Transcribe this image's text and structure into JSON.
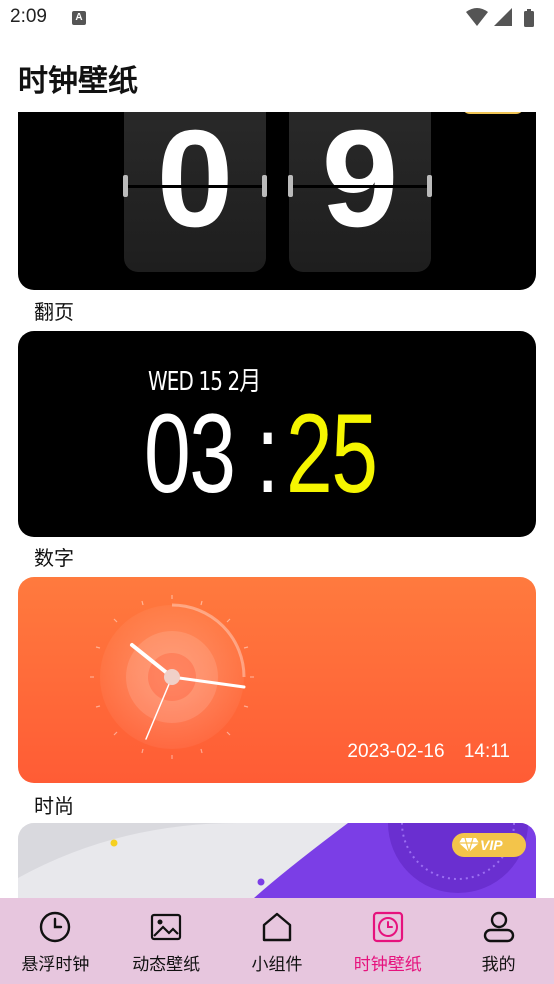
{
  "status_bar": {
    "time": "2:09",
    "notification_icon": "text-a-icon",
    "system_icons": [
      "wifi-icon",
      "signal-icon",
      "battery-icon"
    ]
  },
  "page": {
    "title": "时钟壁纸"
  },
  "cards": [
    {
      "kind": "flip",
      "label": "翻页",
      "digits": [
        "0",
        "9"
      ]
    },
    {
      "kind": "digital",
      "label": "数字",
      "date": "WED 15 2月",
      "hours": "03",
      "colon": ":",
      "minutes": "25",
      "minutes_color": "#f5f500"
    },
    {
      "kind": "fashion",
      "label": "时尚",
      "date": "2023-02-16",
      "time": "14:11"
    },
    {
      "kind": "premium",
      "badge": "VIP",
      "badge_icon": "diamond-icon",
      "accent": "#7b3ee6"
    }
  ],
  "bottom_nav": {
    "active_index": 3,
    "active_color": "#e6127d",
    "items": [
      {
        "label": "悬浮时钟",
        "icon": "clock-icon"
      },
      {
        "label": "动态壁纸",
        "icon": "image-icon"
      },
      {
        "label": "小组件",
        "icon": "home-icon"
      },
      {
        "label": "时钟壁纸",
        "icon": "clock-wallpaper-icon"
      },
      {
        "label": "我的",
        "icon": "person-icon"
      }
    ]
  }
}
